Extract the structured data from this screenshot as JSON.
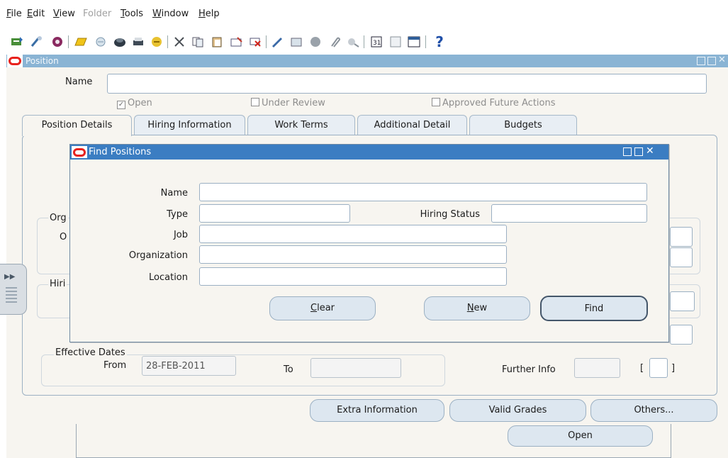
{
  "menu": {
    "items": [
      {
        "label": "File",
        "u": "F",
        "rest": "ile",
        "disabled": false
      },
      {
        "label": "Edit",
        "u": "E",
        "rest": "dit",
        "disabled": false
      },
      {
        "label": "View",
        "u": "V",
        "rest": "iew",
        "disabled": false
      },
      {
        "label": "Folder",
        "u": "",
        "rest": "Folder",
        "disabled": true
      },
      {
        "label": "Tools",
        "u": "T",
        "rest": "ools",
        "disabled": false
      },
      {
        "label": "Window",
        "u": "W",
        "rest": "indow",
        "disabled": false
      },
      {
        "label": "Help",
        "u": "H",
        "rest": "elp",
        "disabled": false
      }
    ]
  },
  "toolbar": {
    "help_glyph": "?",
    "icons": [
      "new-icon",
      "find-icon",
      "navigator-icon",
      "open-folder-icon",
      "save-icon",
      "switch-responsibility-icon",
      "print-icon",
      "close-form-icon",
      "cut-icon",
      "copy-icon",
      "paste-icon",
      "new-record-icon",
      "delete-record-icon",
      "edit-field-icon",
      "zoom-icon",
      "translations-icon",
      "attachments-icon",
      "folder-tools-icon",
      "calendar-icon",
      "date-picker-icon",
      "window-icon"
    ]
  },
  "window": {
    "title": "Position"
  },
  "form": {
    "name_label": "Name",
    "name_value": "",
    "open_label": "Open",
    "under_review_label": "Under Review",
    "approved_future_label": "Approved Future Actions",
    "tabs": [
      {
        "label": "Position Details",
        "active": true
      },
      {
        "label": "Hiring Information",
        "active": false
      },
      {
        "label": "Work Terms",
        "active": false
      },
      {
        "label": "Additional Detail",
        "active": false
      },
      {
        "label": "Budgets",
        "active": false
      }
    ],
    "org_group_label": "Org",
    "org_field_label": "O",
    "hiring_group_label": "Hiri",
    "effective_dates_label": "Effective Dates",
    "from_label": "From",
    "from_value": "28-FEB-2011",
    "to_label": "To",
    "to_value": "",
    "further_info_label": "Further Info",
    "bracket_left": "[",
    "bracket_right": "]",
    "buttons": {
      "extra_information": "Extra Information",
      "valid_grades": "Valid Grades",
      "others": "Others...",
      "open": "Open"
    }
  },
  "find_dialog": {
    "title": "Find Positions",
    "name_label": "Name",
    "type_label": "Type",
    "hiring_status_label": "Hiring Status",
    "job_label": "Job",
    "organization_label": "Organization",
    "location_label": "Location",
    "clear_button": "Clear",
    "new_button": "New",
    "find_button": "Find",
    "values": {
      "name": "",
      "type": "",
      "hiring_status": "",
      "job": "",
      "organization": "",
      "location": ""
    }
  },
  "colors": {
    "dialog_title_bar": "#3b7dc2",
    "window_title_bar": "#8ab4d4",
    "oracle_red": "#e8221d",
    "form_background": "#f7f5f0"
  }
}
